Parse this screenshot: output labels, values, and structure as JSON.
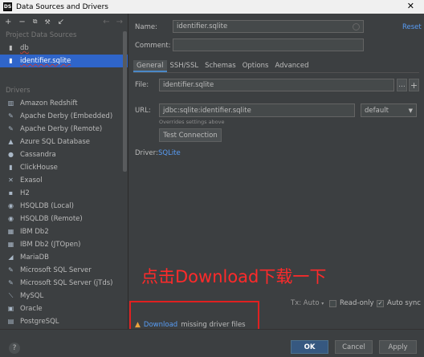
{
  "window": {
    "title": "Data Sources and Drivers",
    "close": "✕"
  },
  "left": {
    "toolbar": {
      "add": "+",
      "remove": "−",
      "copy": "⧉",
      "settings": "🔧",
      "edit": "↙",
      "back": "←",
      "forward": "→"
    },
    "project_header": "Project Data Sources",
    "project_items": [
      {
        "label": "db",
        "icon": "database-icon"
      },
      {
        "label": "identifier.sqlite",
        "icon": "sqlite-icon",
        "selected": true
      }
    ],
    "drivers_header": "Drivers",
    "drivers": [
      "Amazon Redshift",
      "Apache Derby (Embedded)",
      "Apache Derby (Remote)",
      "Azure SQL Database",
      "Cassandra",
      "ClickHouse",
      "Exasol",
      "H2",
      "HSQLDB (Local)",
      "HSQLDB (Remote)",
      "IBM Db2",
      "IBM Db2 (JTOpen)",
      "MariaDB",
      "Microsoft SQL Server",
      "Microsoft SQL Server (jTds)",
      "MySQL",
      "Oracle",
      "PostgreSQL"
    ]
  },
  "form": {
    "name_label": "Name:",
    "name_value": "identifier.sqlite",
    "reset": "Reset",
    "comment_label": "Comment:",
    "comment_value": "",
    "tabs": [
      "General",
      "SSH/SSL",
      "Schemas",
      "Options",
      "Advanced"
    ],
    "file_label": "File:",
    "file_value": "identifier.sqlite",
    "url_label": "URL:",
    "url_value": "jdbc:sqlite:identifier.sqlite",
    "url_mode": "default",
    "overrides_note": "Overrides settings above",
    "test_connection": "Test Connection",
    "driver_label": "Driver:",
    "driver_value": "SQLite",
    "tx_label": "Tx: Auto",
    "readonly_label": "Read-only",
    "autosync_label": "Auto sync",
    "download_link": "Download",
    "download_rest": "missing driver files"
  },
  "annotation": {
    "text": "点击Download下载一下"
  },
  "buttons": {
    "help": "?",
    "ok": "OK",
    "cancel": "Cancel",
    "apply": "Apply"
  },
  "colors": {
    "accent": "#589df6",
    "selected": "#2f65ca",
    "annotation": "#ff2a2a",
    "warning": "#e8a33d"
  }
}
